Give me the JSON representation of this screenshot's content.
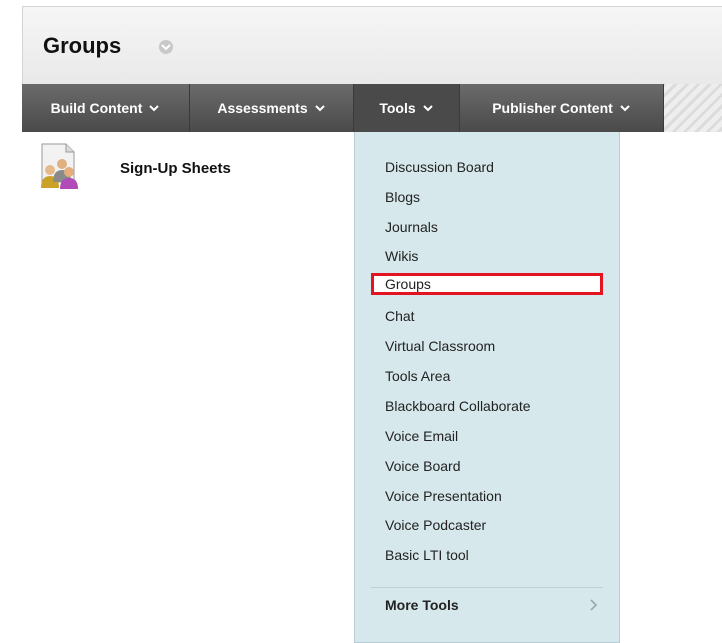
{
  "page": {
    "title": "Groups"
  },
  "toolbar": {
    "buttons": [
      {
        "label": "Build Content"
      },
      {
        "label": "Assessments"
      },
      {
        "label": "Tools",
        "active": true
      },
      {
        "label": "Publisher Content"
      }
    ]
  },
  "content": {
    "item_title": "Sign-Up Sheets",
    "item_icon": "users-group-icon"
  },
  "tools_menu": {
    "items": [
      "Discussion Board",
      "Blogs",
      "Journals",
      "Wikis",
      "Groups",
      "Chat",
      "Virtual Classroom",
      "Tools Area",
      "Blackboard Collaborate",
      "Voice Email",
      "Voice Board",
      "Voice Presentation",
      "Voice Podcaster",
      "Basic LTI tool"
    ],
    "highlighted": "Groups",
    "more_tools": "More Tools"
  },
  "colors": {
    "menu_bg": "#d6e8ec",
    "toolbar_bg": "#555555",
    "highlight_border": "#e3141f"
  }
}
